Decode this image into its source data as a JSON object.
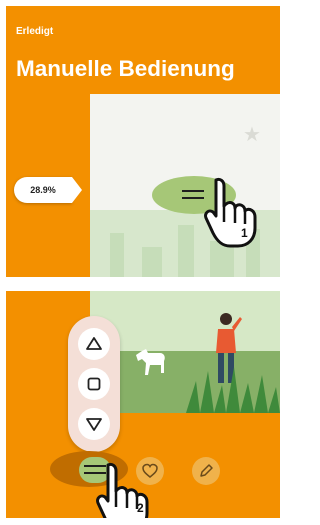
{
  "status": {
    "done_label": "Erledigt"
  },
  "title": "Manuelle Bedienung",
  "progress": {
    "label": "28.9%",
    "value": 0.289
  },
  "steps": {
    "first": "1",
    "second": "2"
  },
  "controls": {
    "up_icon": "triangle-up-icon",
    "stop_icon": "square-icon",
    "down_icon": "triangle-down-icon"
  },
  "bottom_icons": [
    "handle-icon",
    "heart-icon",
    "pencil-icon"
  ],
  "colors": {
    "orange": "#f39000",
    "green_bubble": "#a6c777",
    "dark_orange": "#c06d00",
    "pale_pink": "#f4dfd7"
  }
}
